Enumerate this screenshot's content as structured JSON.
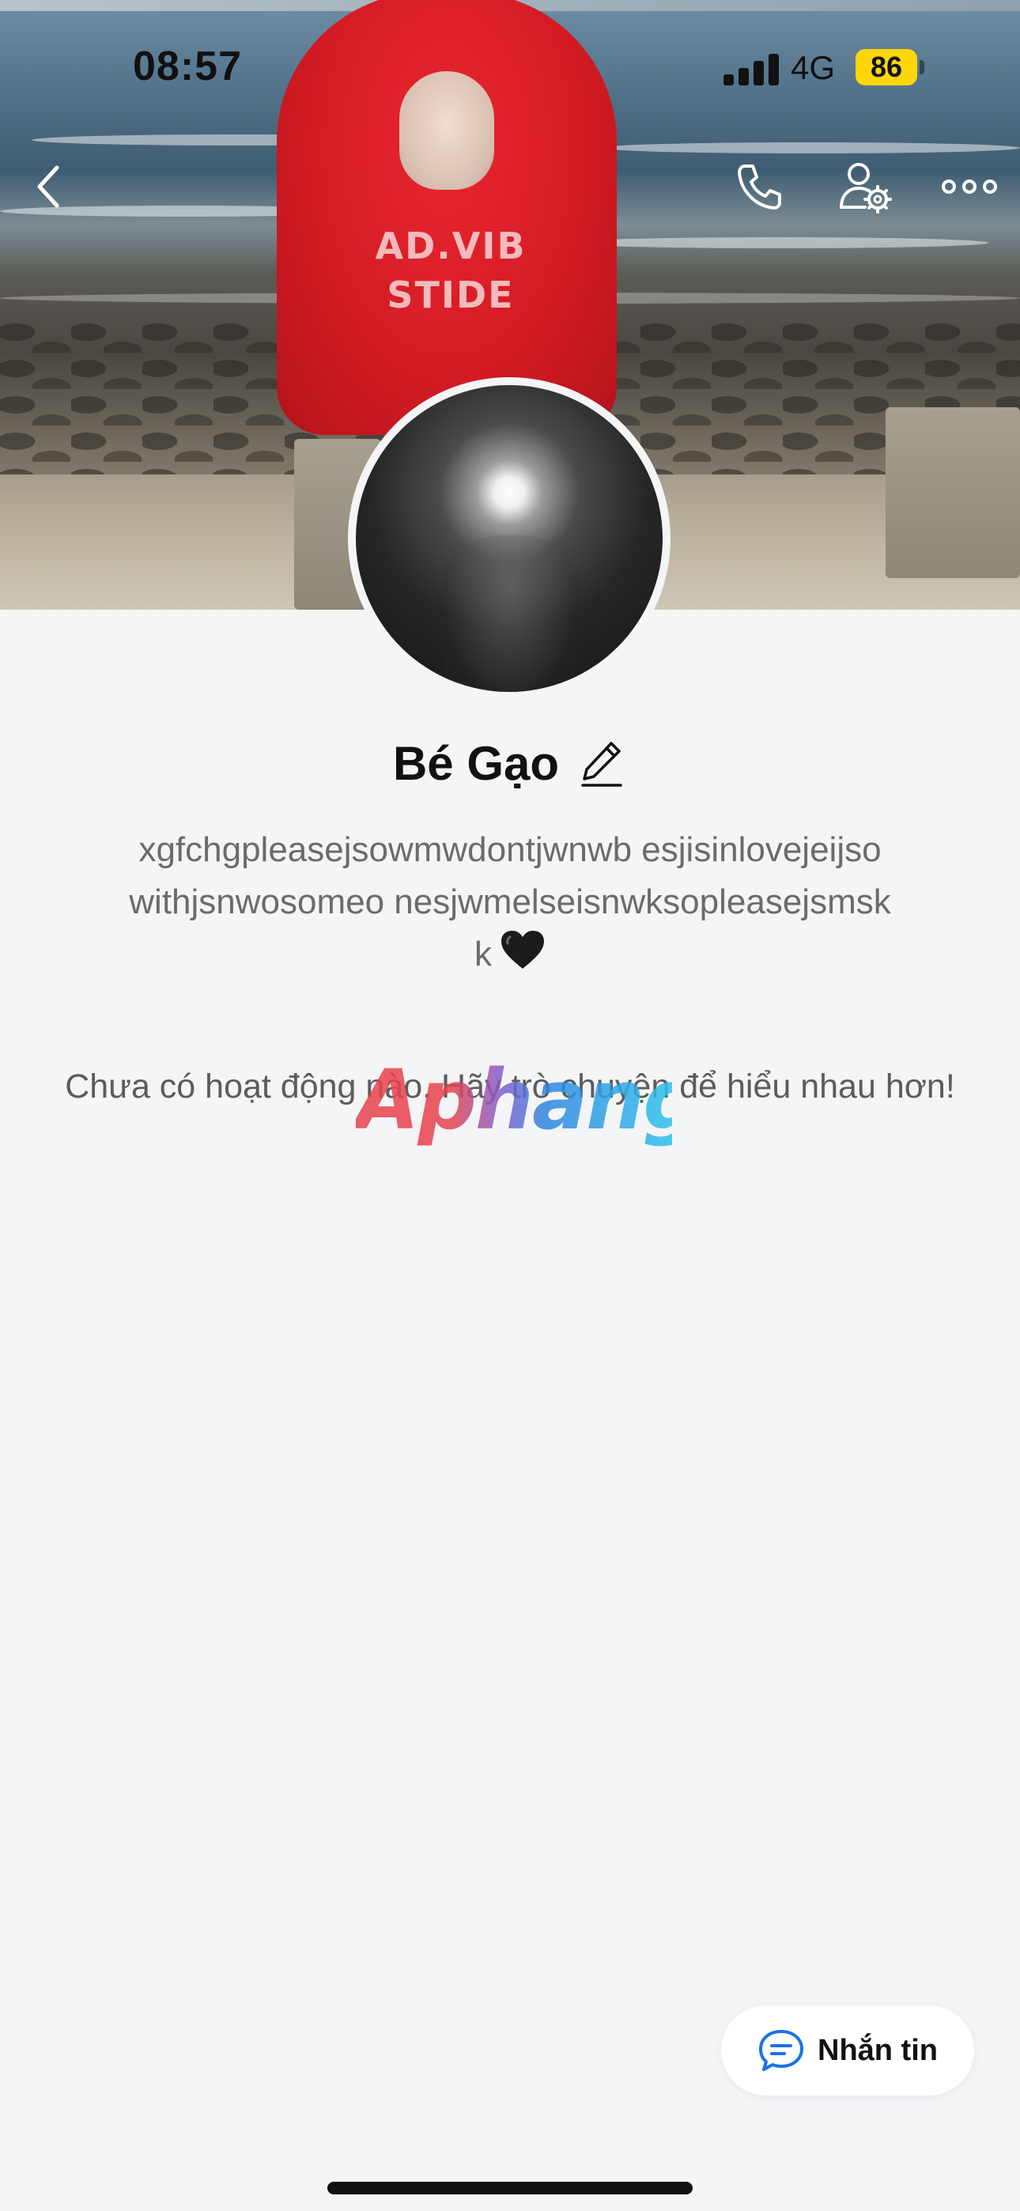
{
  "status_bar": {
    "time": "08:57",
    "network": "4G",
    "battery": "86"
  },
  "cover": {
    "hoodie_print": [
      "AD.VIB",
      "STIDE"
    ]
  },
  "nav": {
    "back_icon": "chevron-left-icon",
    "call_icon": "phone-icon",
    "settings_icon": "user-settings-icon",
    "more_icon": "more-icon"
  },
  "profile": {
    "name": "Bé Gạo",
    "bio": "xgfchgpleasejsowmwdontjwnwb esjisinlovejeijsowithjsnwosomeo nesjwmelseisnwksopleasejsmskk",
    "bio_emoji": "black-heart-icon"
  },
  "activity": {
    "empty_text": "Chưa có hoạt động nào. Hãy trò chuyện để hiểu nhau hơn!"
  },
  "watermark": {
    "text": "Aphang"
  },
  "actions": {
    "message_label": "Nhắn tin"
  },
  "colors": {
    "accent": "#1a73e8",
    "background": "#f4f5f7",
    "battery": "#ffd60a"
  }
}
